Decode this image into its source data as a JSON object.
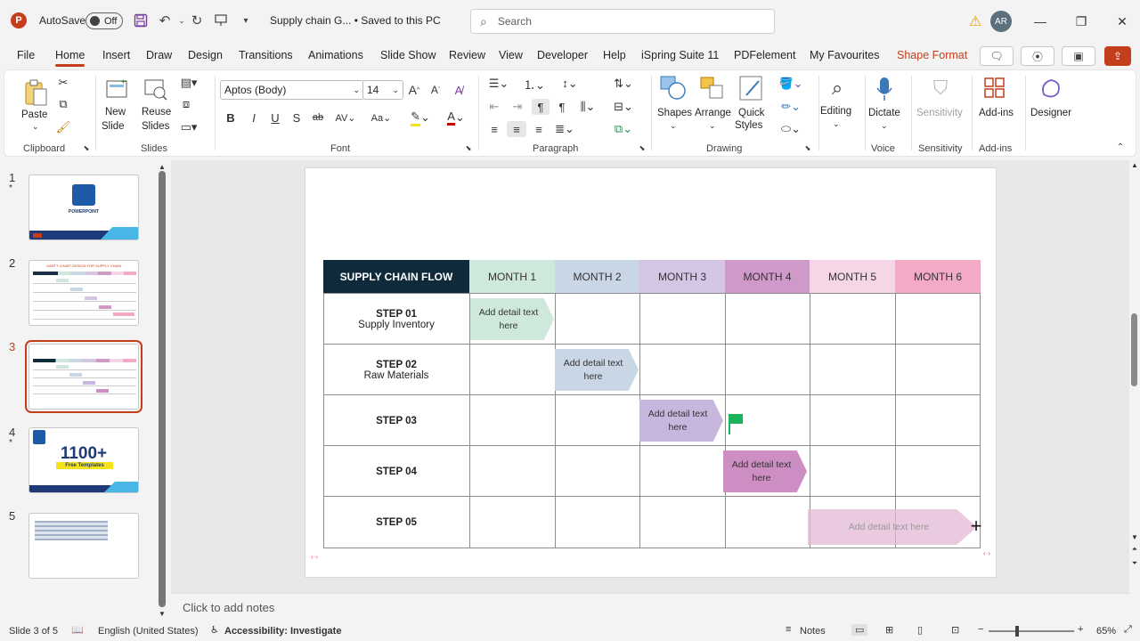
{
  "titlebar": {
    "app_logo": "P",
    "autosave_label": "AutoSave",
    "autosave_state": "Off",
    "doc_title": "Supply chain G... • Saved to this PC",
    "search_placeholder": "Search",
    "avatar_initials": "AR"
  },
  "tabs": [
    "File",
    "Home",
    "Insert",
    "Draw",
    "Design",
    "Transitions",
    "Animations",
    "Slide Show",
    "Review",
    "View",
    "Developer",
    "Help",
    "iSpring Suite 11",
    "PDFelement",
    "My Favourites",
    "Shape Format"
  ],
  "ribbon": {
    "paste": "Paste",
    "new_slide_1": "New",
    "new_slide_2": "Slide",
    "reuse_1": "Reuse",
    "reuse_2": "Slides",
    "font_name": "Aptos (Body)",
    "font_size": "14",
    "shapes": "Shapes",
    "arrange": "Arrange",
    "quick_1": "Quick",
    "quick_2": "Styles",
    "editing": "Editing",
    "dictate": "Dictate",
    "sensitivity": "Sensitivity",
    "addins": "Add-ins",
    "designer": "Designer",
    "groups": {
      "clipboard": "Clipboard",
      "slides": "Slides",
      "font": "Font",
      "paragraph": "Paragraph",
      "drawing": "Drawing",
      "voice": "Voice",
      "sensitivity": "Sensitivity",
      "addins": "Add-ins"
    }
  },
  "thumbnails": [
    {
      "num": "1",
      "star": "*"
    },
    {
      "num": "2",
      "star": ""
    },
    {
      "num": "3",
      "star": ""
    },
    {
      "num": "4",
      "star": "*"
    },
    {
      "num": "5",
      "star": ""
    }
  ],
  "thumb_text": {
    "t1_title": "POWERPOINT",
    "t2_title": "GANTT CHART DESIGN FOR SUPPLY CHAIN",
    "t4_big": "1100+",
    "t4_sub": "Free Templates"
  },
  "gantt": {
    "header": "SUPPLY CHAIN FLOW",
    "months": [
      "MONTH 1",
      "MONTH 2",
      "MONTH 3",
      "MONTH 4",
      "MONTH 5",
      "MONTH 6"
    ],
    "month_colors": [
      "#cfe8dc",
      "#c9d6e6",
      "#d3c5e3",
      "#cf99c9",
      "#f6d6e6",
      "#f4a9c6"
    ],
    "header_color": "#0e2a3b",
    "steps": [
      {
        "label": "STEP 01",
        "sub": "Supply Inventory"
      },
      {
        "label": "STEP 02",
        "sub": "Raw Materials"
      },
      {
        "label": "STEP 03",
        "sub": ""
      },
      {
        "label": "STEP 04",
        "sub": ""
      },
      {
        "label": "STEP 05",
        "sub": ""
      }
    ],
    "bars": [
      {
        "text": "Add detail text here",
        "color": "#cfe8dc"
      },
      {
        "text": "Add detail text here",
        "color": "#c9d6e6"
      },
      {
        "text": "Add detail text here",
        "color": "#c7b6dd"
      },
      {
        "text": "Add detail text here",
        "color": "#cd8fc3"
      },
      {
        "text": "Add detail text here",
        "color": "#e2b8d6"
      }
    ],
    "flag_color": "#1bb35a"
  },
  "notes_placeholder": "Click to add notes",
  "status": {
    "slide": "Slide 3 of 5",
    "language": "English (United States)",
    "accessibility": "Accessibility: Investigate",
    "notes": "Notes",
    "zoom": "65%"
  }
}
